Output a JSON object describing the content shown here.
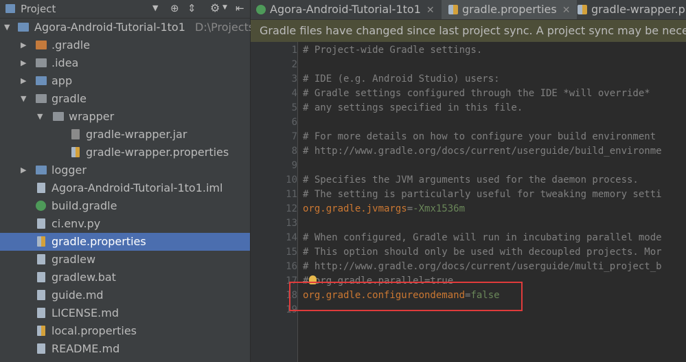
{
  "project_panel": {
    "title": "Project",
    "toolbar_icons": [
      "dropdown-icon",
      "target-icon",
      "collapse-icon",
      "gear-icon",
      "hide-icon"
    ],
    "tree": [
      {
        "label": "Agora-Android-Tutorial-1to1",
        "path": "D:\\Projects",
        "type": "module",
        "expanded": true,
        "depth": 0
      },
      {
        "label": ".gradle",
        "type": "folder-excluded",
        "expanded": false,
        "depth": 1
      },
      {
        "label": ".idea",
        "type": "folder",
        "expanded": false,
        "depth": 1
      },
      {
        "label": "app",
        "type": "folder-module",
        "expanded": false,
        "depth": 1
      },
      {
        "label": "gradle",
        "type": "folder",
        "expanded": true,
        "depth": 1
      },
      {
        "label": "wrapper",
        "type": "folder",
        "expanded": true,
        "depth": 2
      },
      {
        "label": "gradle-wrapper.jar",
        "type": "jar",
        "depth": 3
      },
      {
        "label": "gradle-wrapper.properties",
        "type": "properties",
        "depth": 3
      },
      {
        "label": "logger",
        "type": "folder-module",
        "expanded": false,
        "depth": 1
      },
      {
        "label": "Agora-Android-Tutorial-1to1.iml",
        "type": "file",
        "depth": 1
      },
      {
        "label": "build.gradle",
        "type": "gradle",
        "depth": 1
      },
      {
        "label": "ci.env.py",
        "type": "file",
        "depth": 1
      },
      {
        "label": "gradle.properties",
        "type": "properties",
        "depth": 1,
        "selected": true
      },
      {
        "label": "gradlew",
        "type": "file",
        "depth": 1
      },
      {
        "label": "gradlew.bat",
        "type": "file",
        "depth": 1
      },
      {
        "label": "guide.md",
        "type": "file",
        "depth": 1
      },
      {
        "label": "LICENSE.md",
        "type": "file",
        "depth": 1
      },
      {
        "label": "local.properties",
        "type": "properties",
        "depth": 1
      },
      {
        "label": "README.md",
        "type": "file",
        "depth": 1
      }
    ]
  },
  "tabs": [
    {
      "label": "Agora-Android-Tutorial-1to1",
      "icon": "gradle-icon",
      "active": false
    },
    {
      "label": "gradle.properties",
      "icon": "properties-icon",
      "active": true
    },
    {
      "label": "gradle-wrapper.pr",
      "icon": "properties-icon",
      "active": false
    }
  ],
  "banner": {
    "text": "Gradle files have changed since last project sync. A project sync may be necessary"
  },
  "editor": {
    "lines": [
      {
        "n": "1",
        "text": "# Project-wide Gradle settings."
      },
      {
        "n": "2",
        "text": ""
      },
      {
        "n": "3",
        "text": "# IDE (e.g. Android Studio) users:"
      },
      {
        "n": "4",
        "text": "# Gradle settings configured through the IDE *will override*"
      },
      {
        "n": "5",
        "text": "# any settings specified in this file."
      },
      {
        "n": "6",
        "text": ""
      },
      {
        "n": "7",
        "text": "# For more details on how to configure your build environment"
      },
      {
        "n": "8",
        "text": "# http://www.gradle.org/docs/current/userguide/build_environme"
      },
      {
        "n": "9",
        "text": ""
      },
      {
        "n": "10",
        "text": "# Specifies the JVM arguments used for the daemon process."
      },
      {
        "n": "11",
        "text": "# The setting is particularly useful for tweaking memory setti"
      },
      {
        "n": "12",
        "key": "org.gradle.jvmargs",
        "eq": "=",
        "value": "-Xmx1536m"
      },
      {
        "n": "13",
        "text": ""
      },
      {
        "n": "14",
        "text": "# When configured, Gradle will run in incubating parallel mode"
      },
      {
        "n": "15",
        "text": "# This option should only be used with decoupled projects. Mor"
      },
      {
        "n": "16",
        "text": "# http://www.gradle.org/docs/current/userguide/multi_project_b"
      },
      {
        "n": "17",
        "text": "# org.gradle.parallel=true"
      },
      {
        "n": "18",
        "key": "org.gradle.configureondemand",
        "eq": "=",
        "value": "false"
      },
      {
        "n": "19",
        "text": ""
      }
    ]
  },
  "colors": {
    "accent_selection": "#4b6eaf",
    "banner_bg": "#4d4e38",
    "highlight_box": "#e03b3b"
  }
}
